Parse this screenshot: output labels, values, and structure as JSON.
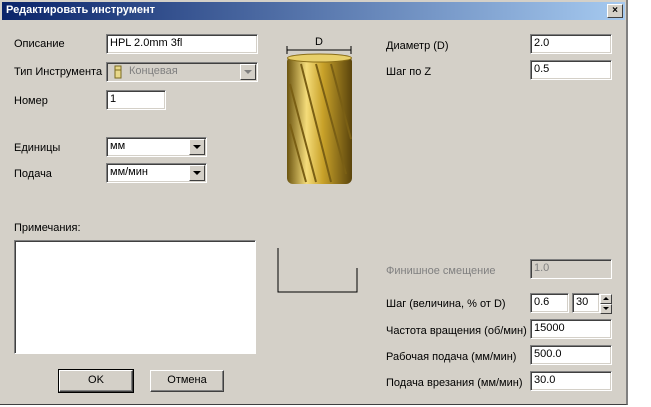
{
  "window": {
    "title": "Редактировать инструмент",
    "close_glyph": "×"
  },
  "left": {
    "description_label": "Описание",
    "description_value": "HPL 2.0mm 3fl",
    "tool_type_label": "Тип Инструмента",
    "tool_type_value": "Концевая",
    "number_label": "Номер",
    "number_value": "1",
    "units_label": "Единицы",
    "units_value": "мм",
    "feed_label": "Подача",
    "feed_value": "мм/мин",
    "notes_label": "Примечания:",
    "notes_value": ""
  },
  "diagram": {
    "dimension_label": "D"
  },
  "right": {
    "diameter_label": "Диаметр (D)",
    "diameter_value": "2.0",
    "stepz_label": "Шаг по Z",
    "stepz_value": "0.5",
    "finish_label": "Финишное смещение",
    "finish_value": "1.0",
    "stepover_label": "Шаг (величина, % от D)",
    "stepover_value": "0.6",
    "stepover_percent": "30",
    "spindle_label": "Частота вращения (об/мин)",
    "spindle_value": "15000",
    "feedrate_label": "Рабочая подача (мм/мин)",
    "feedrate_value": "500.0",
    "plunge_label": "Подача врезания (мм/мин)",
    "plunge_value": "30.0"
  },
  "buttons": {
    "ok": "OK",
    "cancel": "Отмена"
  },
  "colors": {
    "title_start": "#0a246a",
    "title_end": "#a6caf0",
    "dialog_bg": "#d4d0c8",
    "tool_gold": "#c9a22a"
  }
}
